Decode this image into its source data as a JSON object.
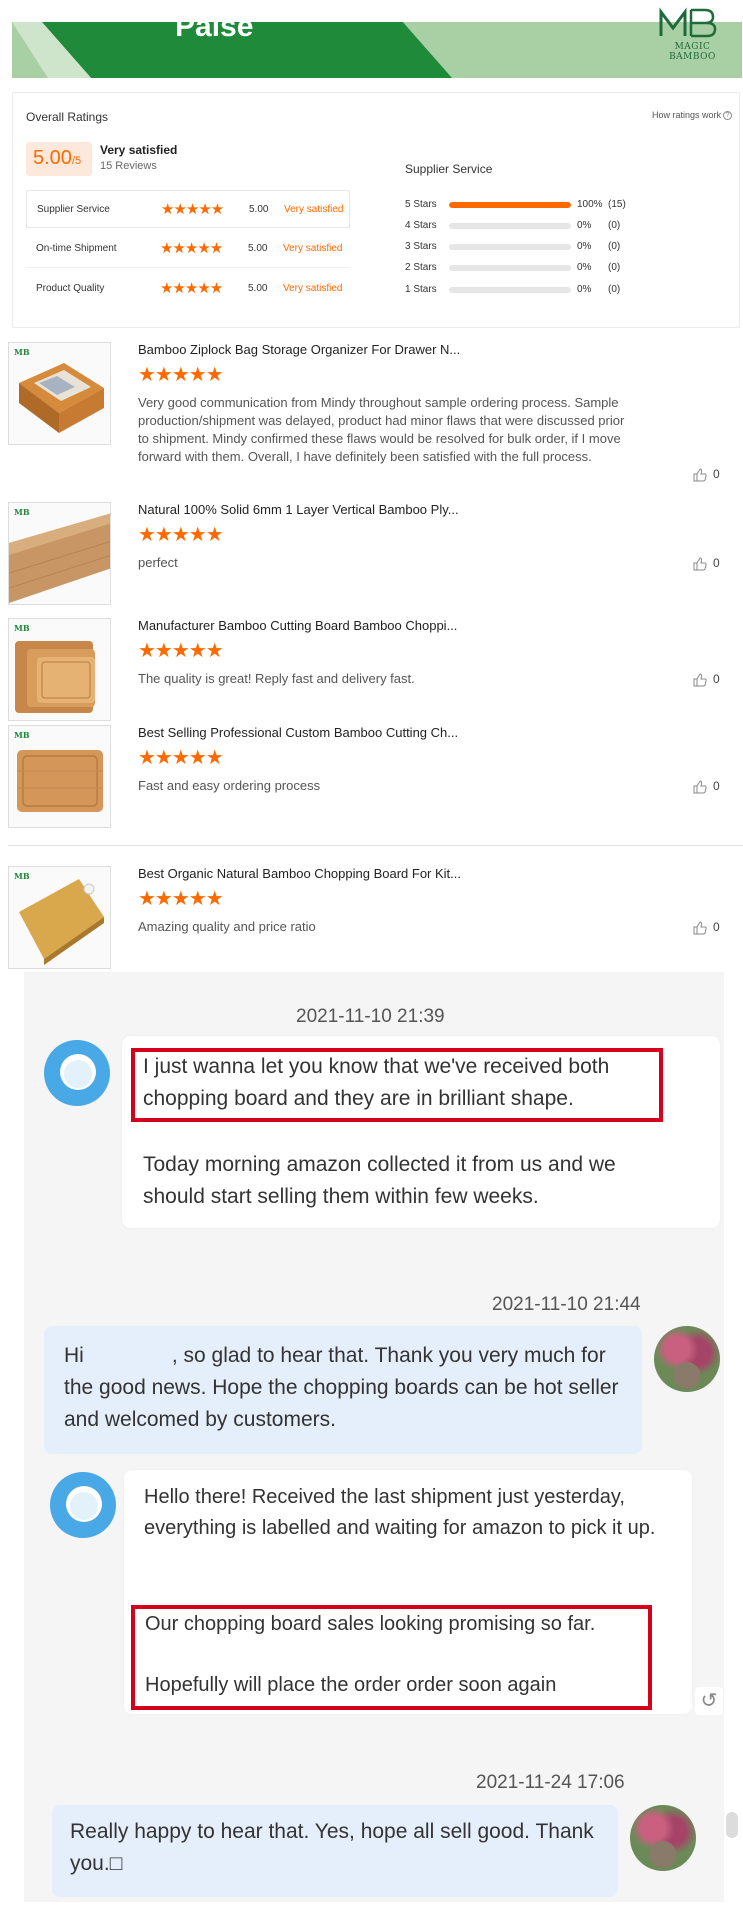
{
  "banner": {
    "title": "Paise",
    "logo_letters": "MB",
    "logo_text": "MAGIC BAMBOO"
  },
  "ratings": {
    "title": "Overall Ratings",
    "how_link": "How ratings work",
    "score": "5.00",
    "score_suffix": "/5",
    "satisfaction": "Very satisfied",
    "review_count": "15 Reviews",
    "metrics": [
      {
        "label": "Supplier Service",
        "stars": "★★★★★",
        "score": "5.00",
        "satisfaction": "Very satisfied"
      },
      {
        "label": "On-time Shipment",
        "stars": "★★★★★",
        "score": "5.00",
        "satisfaction": "Very satisfied"
      },
      {
        "label": "Product Quality",
        "stars": "★★★★★",
        "score": "5.00",
        "satisfaction": "Very satisfied"
      }
    ],
    "breakdown_title": "Supplier Service",
    "breakdown": [
      {
        "label": "5 Stars",
        "fraction": 1.0,
        "percent": "100%",
        "count": "(15)"
      },
      {
        "label": "4 Stars",
        "fraction": 0,
        "percent": "0%",
        "count": "(0)"
      },
      {
        "label": "3 Stars",
        "fraction": 0,
        "percent": "0%",
        "count": "(0)"
      },
      {
        "label": "2 Stars",
        "fraction": 0,
        "percent": "0%",
        "count": "(0)"
      },
      {
        "label": "1 Stars",
        "fraction": 0,
        "percent": "0%",
        "count": "(0)"
      }
    ],
    "accent_color": "#ff6a00"
  },
  "reviews": [
    {
      "title": "Bamboo Ziplock Bag Storage Organizer For Drawer N...",
      "stars": "★★★★★",
      "text": "Very good communication from Mindy throughout sample ordering process. Sample production/shipment was delayed, product had minor flaws that were discussed prior to shipment. Mindy confirmed these flaws would be resolved for bulk order, if I move forward with them. Overall, I have definitely been satisfied with the full process.",
      "likes": "0",
      "thumb_logo": "MB"
    },
    {
      "title": "Natural 100% Solid 6mm 1 Layer Vertical Bamboo Ply...",
      "stars": "★★★★★",
      "text": "perfect",
      "likes": "0",
      "thumb_logo": "MB"
    },
    {
      "title": "Manufacturer Bamboo Cutting Board Bamboo Choppi...",
      "stars": "★★★★★",
      "text": "The quality is great! Reply fast and delivery fast.",
      "likes": "0",
      "thumb_logo": "MB"
    },
    {
      "title": "Best Selling Professional Custom Bamboo Cutting Ch...",
      "stars": "★★★★★",
      "text": "Fast and easy ordering process",
      "likes": "0",
      "thumb_logo": "MB"
    },
    {
      "title": "Best Organic Natural Bamboo Chopping Board For Kit...",
      "stars": "★★★★★",
      "text": "Amazing quality and price ratio",
      "likes": "0",
      "thumb_logo": "MB"
    }
  ],
  "chat": {
    "ts1": "2021-11-10 21:39",
    "msg1_highlight": "I just wanna let you know that we've received both chopping board and they are in brilliant shape.",
    "msg1_rest": "Today morning amazon collected it from us and we should start selling them within few weeks.",
    "ts2": "2021-11-10 21:44",
    "msg2_hi": "Hi",
    "msg2_rest": ", so glad to hear that. Thank you very much for the good news. Hope the chopping boards can be hot seller and welcomed by customers.",
    "msg3_intro": "Hello there! Received the last shipment just yesterday, everything is labelled and waiting for amazon to pick it up.",
    "msg3_line1": "Our chopping board sales looking promising so far.",
    "msg3_line2": "Hopefully will place the order order soon again",
    "ts3": "2021-11-24 17:06",
    "msg4": "Really happy to hear that. Yes, hope all sell good. Thank you.□",
    "reply_icon": "↺"
  }
}
